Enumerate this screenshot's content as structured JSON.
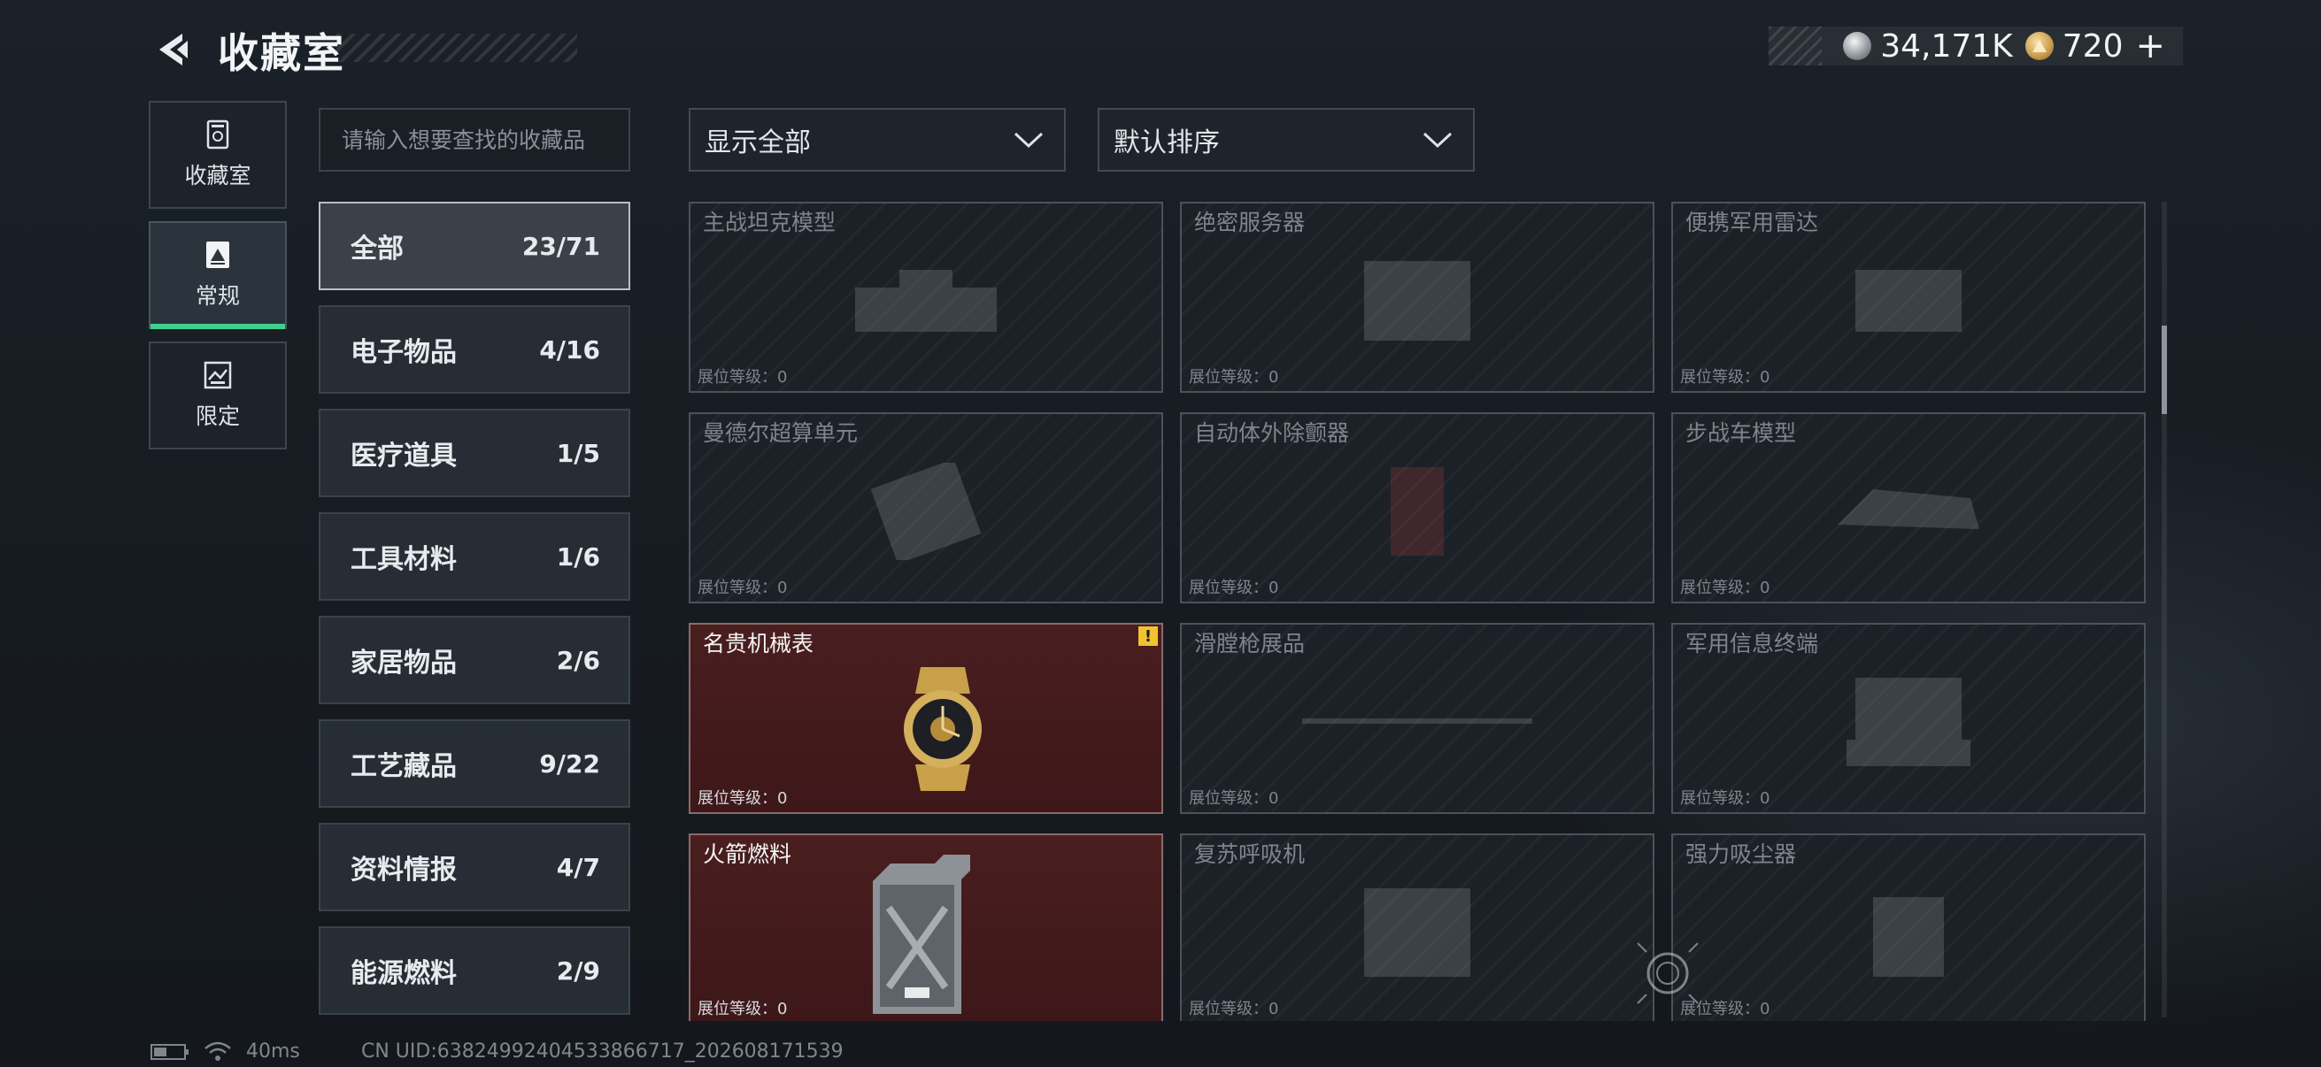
{
  "header": {
    "title": "收藏室",
    "currencies": [
      {
        "icon": "silver-coin-icon",
        "value": "34,171K"
      },
      {
        "icon": "gold-coin-icon",
        "value": "720"
      }
    ],
    "plus": "+"
  },
  "nav": {
    "tabs": [
      {
        "label": "收藏室",
        "icon": "collection-room-icon"
      },
      {
        "label": "常规",
        "icon": "regular-collection-icon"
      },
      {
        "label": "限定",
        "icon": "limited-collection-icon"
      }
    ],
    "active_index": 1
  },
  "search": {
    "placeholder": "请输入想要查找的收藏品"
  },
  "categories": [
    {
      "name": "全部",
      "count": "23/71"
    },
    {
      "name": "电子物品",
      "count": "4/16"
    },
    {
      "name": "医疗道具",
      "count": "1/5"
    },
    {
      "name": "工具材料",
      "count": "1/6"
    },
    {
      "name": "家居物品",
      "count": "2/6"
    },
    {
      "name": "工艺藏品",
      "count": "9/22"
    },
    {
      "name": "资料情报",
      "count": "4/7"
    },
    {
      "name": "能源燃料",
      "count": "2/9"
    }
  ],
  "filters": {
    "display": "显示全部",
    "sort": "默认排序"
  },
  "items": [
    {
      "name": "主战坦克模型",
      "level": "展位等级：0",
      "owned": false
    },
    {
      "name": "绝密服务器",
      "level": "展位等级：0",
      "owned": false
    },
    {
      "name": "便携军用雷达",
      "level": "展位等级：0",
      "owned": false
    },
    {
      "name": "曼德尔超算单元",
      "level": "展位等级：0",
      "owned": false
    },
    {
      "name": "自动体外除颤器",
      "level": "展位等级：0",
      "owned": false
    },
    {
      "name": "步战车模型",
      "level": "展位等级：0",
      "owned": false
    },
    {
      "name": "名贵机械表",
      "level": "展位等级：0",
      "owned": true,
      "alert": "!"
    },
    {
      "name": "滑膛枪展品",
      "level": "展位等级：0",
      "owned": false
    },
    {
      "name": "军用信息终端",
      "level": "展位等级：0",
      "owned": false
    },
    {
      "name": "火箭燃料",
      "level": "展位等级：0",
      "owned": true
    },
    {
      "name": "复苏呼吸机",
      "level": "展位等级：0",
      "owned": false
    },
    {
      "name": "强力吸尘器",
      "level": "展位等级：0",
      "owned": false
    }
  ],
  "footer": {
    "latency": "40ms",
    "uid": "CN UID:6382499240453386671​7_202608171539"
  }
}
